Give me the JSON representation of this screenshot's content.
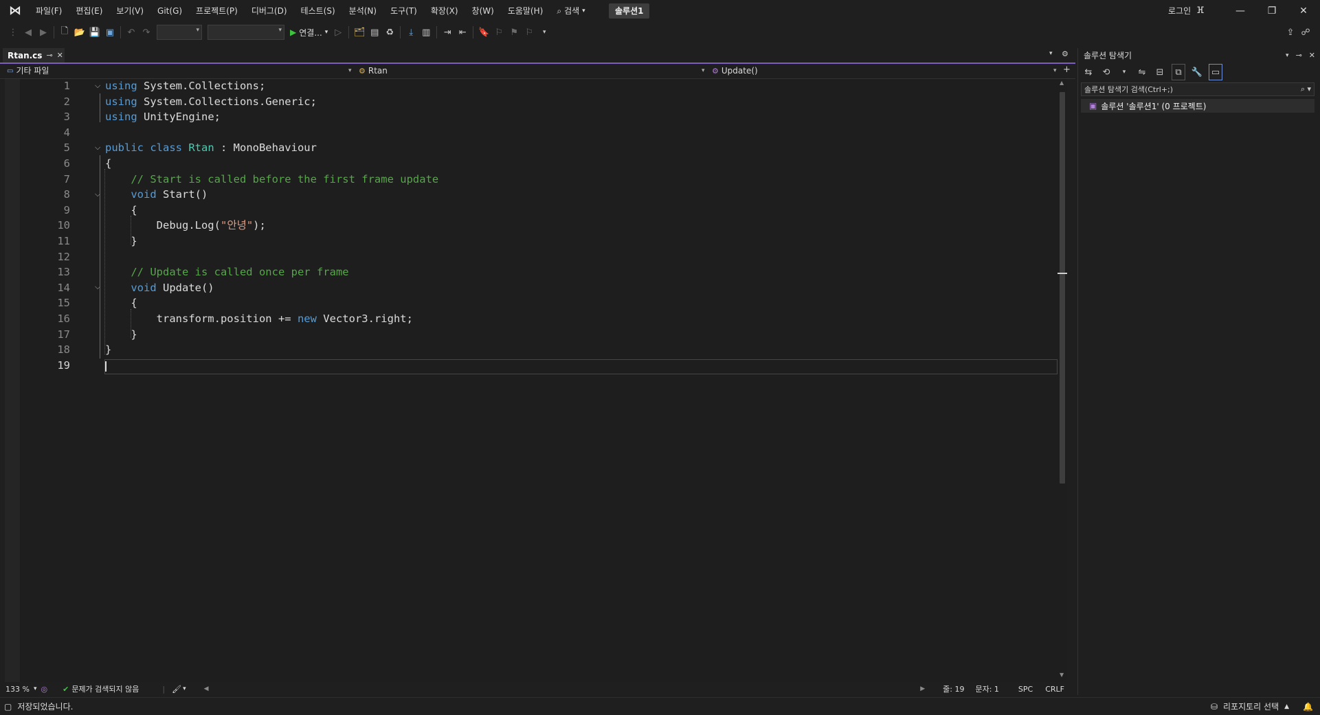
{
  "titlebar": {
    "menu": [
      "파일(F)",
      "편집(E)",
      "보기(V)",
      "Git(G)",
      "프로젝트(P)",
      "디버그(D)",
      "테스트(S)",
      "분석(N)",
      "도구(T)",
      "확장(X)",
      "창(W)",
      "도움말(H)"
    ],
    "search_label": "검색",
    "solution_name": "솔루션1",
    "login_label": "로그인"
  },
  "toolbar": {
    "run_label": "연결..."
  },
  "editor_tabs": [
    {
      "label": "Rtan.cs",
      "active": true
    }
  ],
  "navbar": {
    "scope": "기타 파일",
    "type": "Rtan",
    "member": "Update()"
  },
  "code": {
    "lines": [
      "1",
      "2",
      "3",
      "4",
      "5",
      "6",
      "7",
      "8",
      "9",
      "10",
      "11",
      "12",
      "13",
      "14",
      "15",
      "16",
      "17",
      "18",
      "19"
    ],
    "current_line": "19"
  },
  "editor_status": {
    "zoom": "133 %",
    "issues": "문제가 검색되지 않음",
    "line": "줄: 19",
    "col": "문자: 1",
    "whitespace": "SPC",
    "eol": "CRLF"
  },
  "solution_explorer": {
    "title": "솔루션 탐색기",
    "search_placeholder": "솔루션 탐색기 검색(Ctrl+;)",
    "root_item": "솔루션 '솔루션1' (0 프로젝트)"
  },
  "statusbar": {
    "message": "저장되었습니다.",
    "repo": "리포지토리 선택"
  },
  "colors": {
    "accent": "#7a5ec0",
    "keyword": "#569cd6",
    "class": "#4ec9b0",
    "comment": "#57a64a",
    "string": "#d69d85"
  }
}
